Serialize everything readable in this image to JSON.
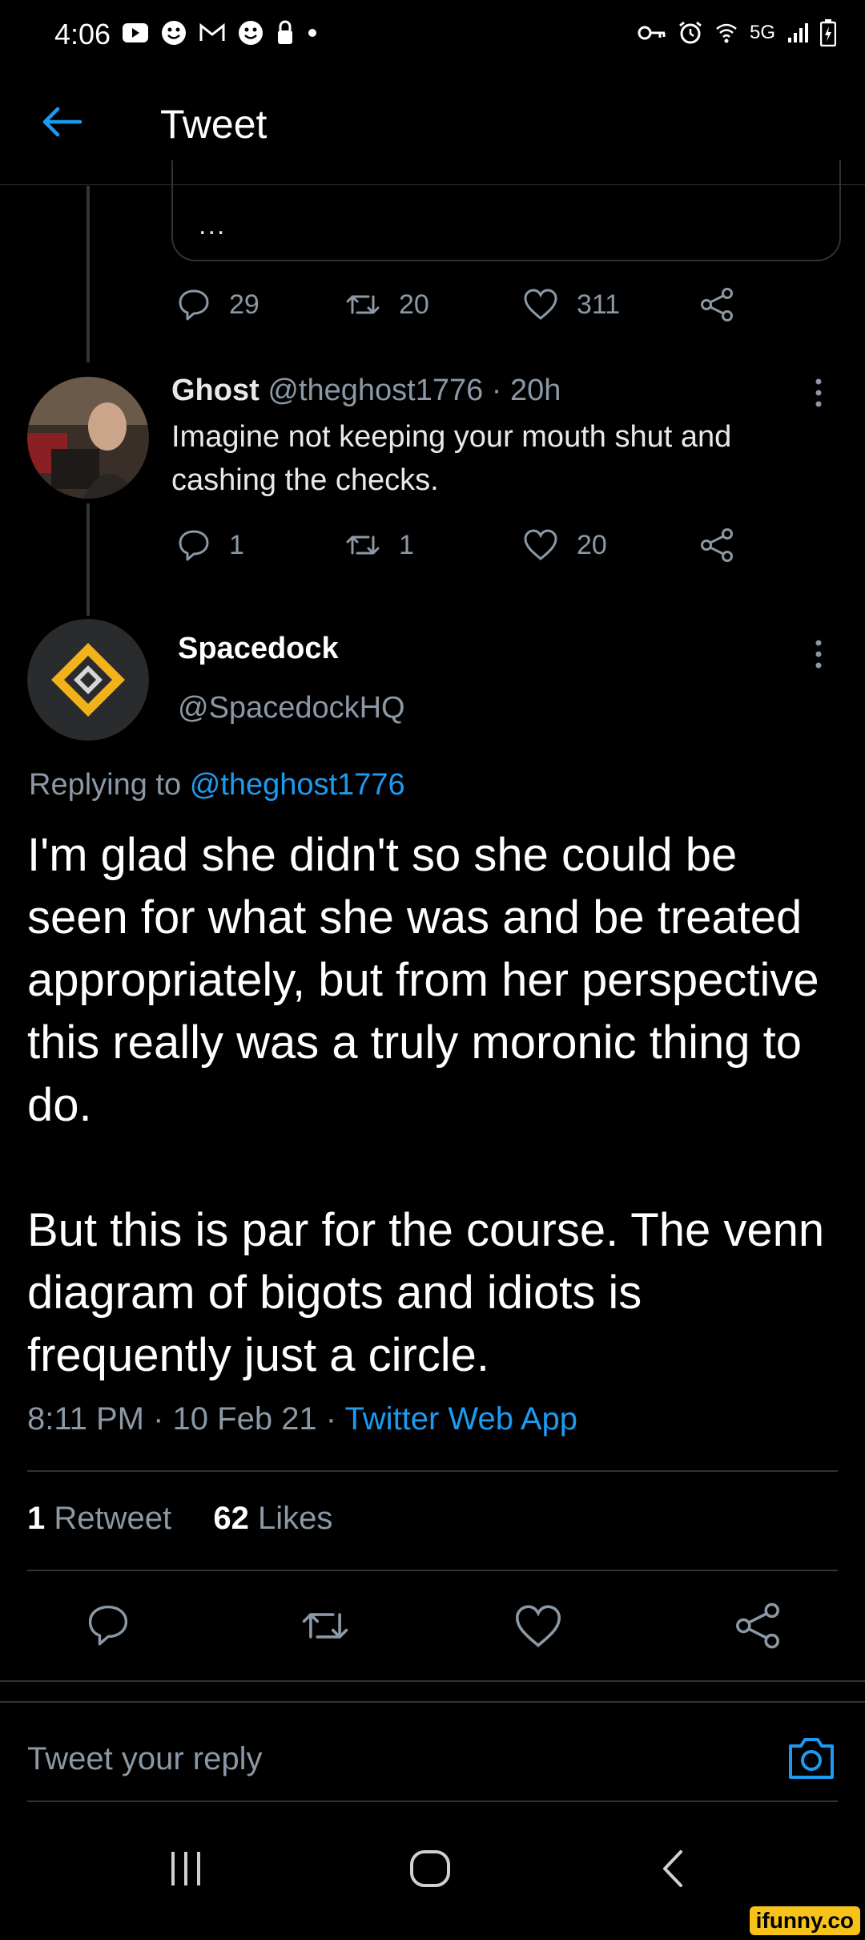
{
  "status_bar": {
    "time": "4:06",
    "network": "5G",
    "left_icons": [
      "youtube-icon",
      "smiley-icon",
      "gmail-icon",
      "smiley-icon",
      "lock-icon",
      "dot-icon"
    ],
    "right_icons": [
      "key-icon",
      "alarm-icon",
      "wifi-icon",
      "signal-icon",
      "battery-icon"
    ]
  },
  "header": {
    "title": "Tweet"
  },
  "quoted_card": {
    "ellipsis": "..."
  },
  "parent_tweet_actions": {
    "replies": "29",
    "retweets": "20",
    "likes": "311"
  },
  "ghost_tweet": {
    "name": "Ghost",
    "handle_time": "@theghost1776 · 20h",
    "text": "Imagine not keeping your mouth shut and cashing the checks.",
    "replies": "1",
    "retweets": "1",
    "likes": "20"
  },
  "main_tweet": {
    "name": "Spacedock",
    "handle": "@SpacedockHQ",
    "replying_prefix": "Replying to",
    "replying_handle": "@theghost1776",
    "paragraph1": "I'm glad she didn't so she could be seen for what she was and be treated appropriately, but from her perspective this really was a truly moronic thing to do.",
    "paragraph2": "But this is par for the course. The venn diagram of bigots and idiots is frequently just a circle.",
    "timestamp": "8:11 PM · 10 Feb 21 · ",
    "source": "Twitter Web App",
    "retweet_count": "1",
    "retweet_label": "Retweet",
    "like_count": "62",
    "like_label": "Likes"
  },
  "reply_bar": {
    "placeholder": "Tweet your reply"
  },
  "watermark": "ifunny.co",
  "colors": {
    "accent": "#1d9bf0",
    "background": "#000000",
    "muted": "#8b98a5",
    "divider": "#2f3336"
  }
}
